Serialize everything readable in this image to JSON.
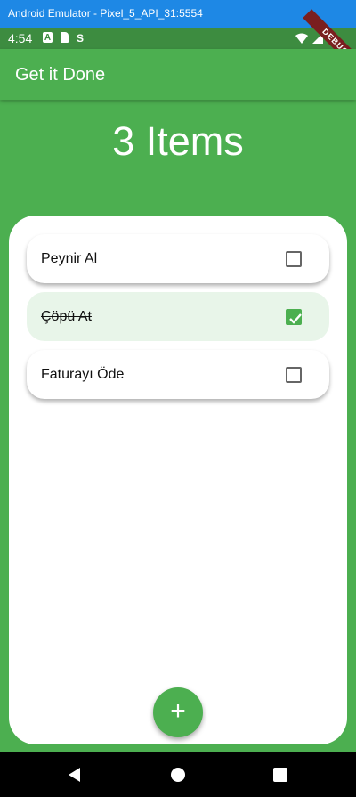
{
  "window": {
    "title": "Android Emulator - Pixel_5_API_31:5554"
  },
  "status_bar": {
    "time": "4:54",
    "left_icons": [
      "a-box-icon",
      "sd-card-icon",
      "sync-icon"
    ],
    "right_icons": [
      "wifi-icon",
      "signal-icon",
      "battery-icon"
    ]
  },
  "debug_banner": {
    "label": "DEBUG"
  },
  "app_bar": {
    "title": "Get it Done"
  },
  "summary": {
    "count_text": "3 Items"
  },
  "tasks": [
    {
      "label": "Peynir Al",
      "done": false
    },
    {
      "label": "Çöpü At",
      "done": true
    },
    {
      "label": "Faturayı Öde",
      "done": false
    }
  ],
  "fab": {
    "icon": "add-icon",
    "symbol": "+"
  },
  "colors": {
    "primary": "#4caf50",
    "done_tile": "#e8f5e9",
    "title_bar": "#1e88e5"
  },
  "navigation": {
    "buttons": [
      "back-icon",
      "home-icon",
      "recents-icon"
    ]
  }
}
